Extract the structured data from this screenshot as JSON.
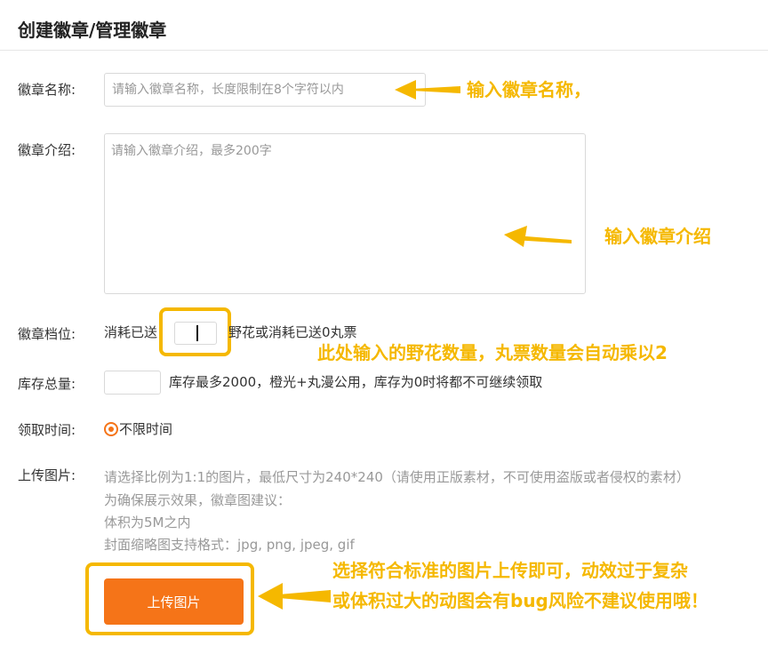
{
  "page": {
    "title": "创建徽章/管理徽章"
  },
  "form": {
    "name": {
      "label": "徽章名称:",
      "placeholder": "请输入徽章名称，长度限制在8个字符以内",
      "value": ""
    },
    "intro": {
      "label": "徽章介绍:",
      "placeholder": "请输入徽章介绍，最多200字",
      "value": ""
    },
    "tier": {
      "label": "徽章档位:",
      "prefix": "消耗已送",
      "suffix": "野花或消耗已送0丸票",
      "value": ""
    },
    "stock": {
      "label": "库存总量:",
      "hint": "库存最多2000，橙光+丸漫公用，库存为0时将都不可继续领取",
      "value": ""
    },
    "claim_time": {
      "label": "领取时间:",
      "option": "不限时间",
      "selected": true
    },
    "upload": {
      "label": "上传图片:",
      "hints": [
        "请选择比例为1:1的图片，最低尺寸为240*240（请使用正版素材，不可使用盗版或者侵权的素材）",
        "为确保展示效果，徽章图建议：",
        "体积为5M之内",
        "封面缩略图支持格式：jpg, png, jpeg, gif"
      ],
      "button_label": "上传图片"
    }
  },
  "annotations": {
    "name": "输入徽章名称，",
    "intro": "输入徽章介绍",
    "tier": "此处输入的野花数量，丸票数量会自动乘以2",
    "upload_line1": "选择符合标准的图片上传即可，动效过于复杂",
    "upload_line2": "或体积过大的动图会有bug风险不建议使用哦！"
  },
  "colors": {
    "accent": "#f57418",
    "annotation": "#f5b800",
    "placeholder": "#999999",
    "border": "#d9d9d9"
  }
}
